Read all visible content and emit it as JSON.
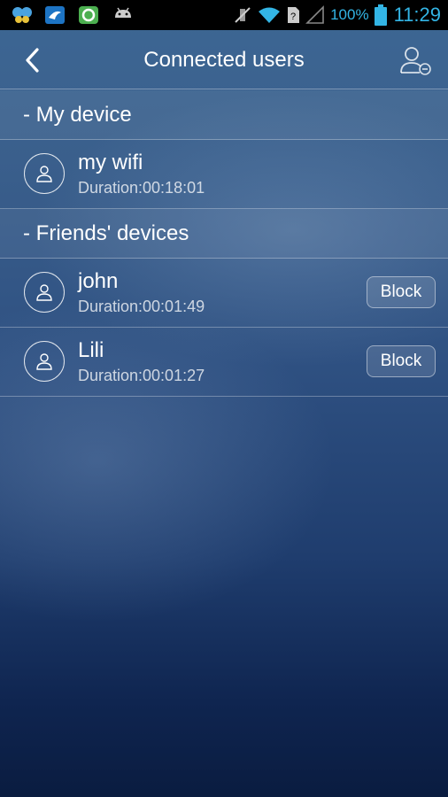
{
  "statusbar": {
    "battery_percent": "100%",
    "time": "11:29",
    "icons": [
      "butterfly-app-icon",
      "bird-app-icon",
      "circle-app-icon",
      "android-icon",
      "mute-icon",
      "wifi-icon",
      "sim-unknown-icon",
      "signal-icon",
      "battery-icon"
    ]
  },
  "header": {
    "title": "Connected users",
    "back_icon": "chevron-left-icon",
    "menu_icon": "user-minus-icon"
  },
  "sections": [
    {
      "label": "- My device",
      "devices": [
        {
          "name": "my wifi",
          "duration": "Duration:00:18:01"
        }
      ]
    },
    {
      "label": "- Friends' devices",
      "devices": [
        {
          "name": "john",
          "duration": "Duration:00:01:49",
          "action": "Block"
        },
        {
          "name": "Lili",
          "duration": "Duration:00:01:27",
          "action": "Block"
        }
      ]
    }
  ],
  "colors": {
    "status_accent": "#33b5e5",
    "background_top": "#3d6794",
    "background_bottom": "#0a1c40"
  }
}
